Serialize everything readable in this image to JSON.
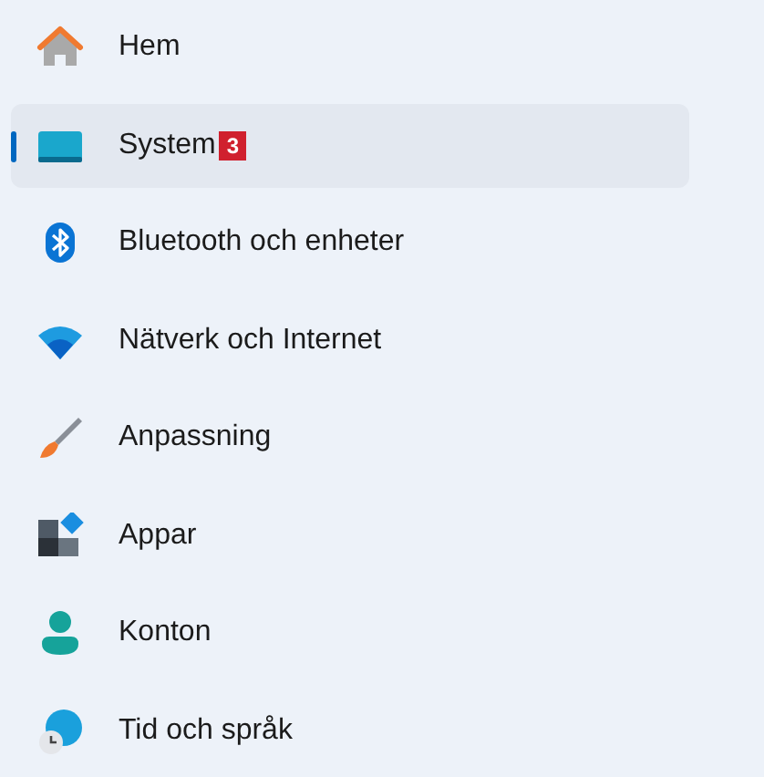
{
  "sidebar": {
    "items": [
      {
        "kind": "home",
        "label": "Hem",
        "selected": false
      },
      {
        "kind": "system",
        "label": "System",
        "selected": true,
        "badge": "3"
      },
      {
        "kind": "bluetooth",
        "label": "Bluetooth och enheter",
        "selected": false
      },
      {
        "kind": "network",
        "label": "Nätverk och Internet",
        "selected": false
      },
      {
        "kind": "personalization",
        "label": "Anpassning",
        "selected": false
      },
      {
        "kind": "apps",
        "label": "Appar",
        "selected": false
      },
      {
        "kind": "accounts",
        "label": "Konton",
        "selected": false
      },
      {
        "kind": "time",
        "label": "Tid och språk",
        "selected": false
      }
    ]
  }
}
